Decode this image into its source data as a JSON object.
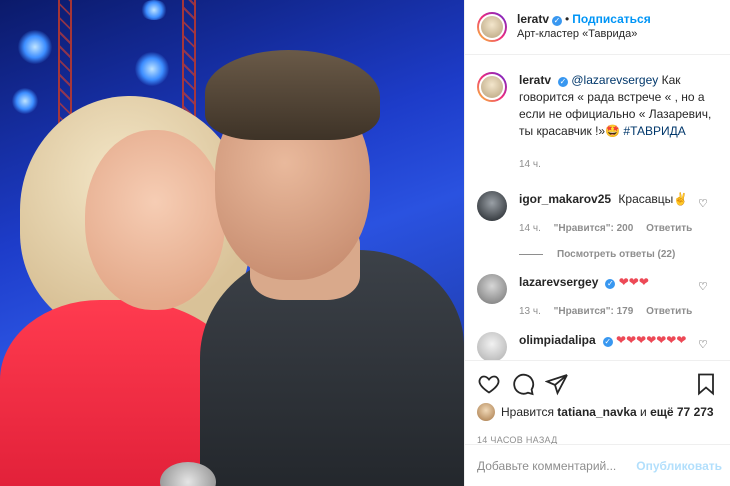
{
  "colors": {
    "accent": "#0095f6",
    "text": "#262626",
    "muted": "#8e8e8e",
    "heart_red": "#ed4956",
    "hashtag": "#00376b"
  },
  "header": {
    "username": "leratv",
    "verified_icon": "verified-check-icon",
    "separator": "•",
    "follow_label": "Подписаться",
    "location": "Арт-кластер «Таврида»"
  },
  "caption": {
    "username": "leratv",
    "mention": "@lazarevsergey",
    "text": "Как говорится « рада встрече « , но а если не официально « Лазаревич, ты красавчик !»🤩",
    "hashtag": "#ТАВРИДА",
    "time": "14 ч."
  },
  "comments": [
    {
      "username": "igor_makarov25",
      "text": "Красавцы✌",
      "time": "14 ч.",
      "likes": "\"Нравится\": 200",
      "reply": "Ответить",
      "replies": "Посмотреть ответы (22)"
    },
    {
      "username": "lazarevsergey",
      "text": "❤❤❤",
      "time": "13 ч.",
      "likes": "\"Нравится\": 179",
      "reply": "Ответить"
    },
    {
      "username": "olimpiadalipa",
      "text": "❤❤❤❤❤❤❤"
    }
  ],
  "actions": {
    "liked_prefix": "Нравится",
    "liked_user": "tatiana_navka",
    "liked_and": "и",
    "liked_rest": "ещё 77 273",
    "time_caps": "14 ЧАСОВ НАЗАД"
  },
  "add_comment": {
    "placeholder": "Добавьте комментарий...",
    "publish_label": "Опубликовать"
  }
}
